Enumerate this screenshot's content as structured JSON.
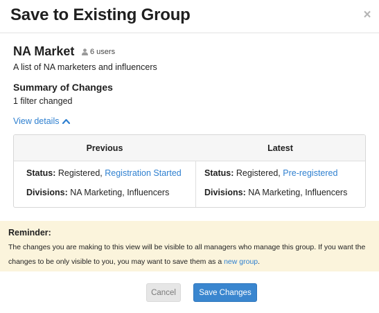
{
  "dialog": {
    "title": "Save to Existing Group",
    "close_glyph": "×"
  },
  "group": {
    "name": "NA Market",
    "user_count": "6 users",
    "user_icon": "user-icon",
    "description": "A list of NA marketers and influencers"
  },
  "summary": {
    "title": "Summary of Changes",
    "subtitle": "1 filter changed",
    "view_details": "View details",
    "view_details_icon": "chevron-up-icon"
  },
  "comparison": {
    "headers": [
      "Previous",
      "Latest"
    ],
    "previous": {
      "status_label": "Status:",
      "status_value": " Registered, ",
      "status_link": "Registration Started",
      "divisions_label": "Divisions:",
      "divisions_value": " NA Marketing, Influencers"
    },
    "latest": {
      "status_label": "Status:",
      "status_value": " Registered, ",
      "status_link": "Pre-registered",
      "divisions_label": "Divisions:",
      "divisions_value": " NA Marketing, Influencers"
    }
  },
  "reminder": {
    "title": "Reminder:",
    "body_text": "The changes you are making to this view will be visible to all managers who manage this group. If you want the changes to be only visible to you, you may want to save them as a ",
    "link_text": "new group",
    "body_end": "."
  },
  "buttons": {
    "cancel": "Cancel",
    "save": "Save Changes"
  },
  "colors": {
    "link": "#2f80d0",
    "primary_button": "#3a86cf",
    "reminder_background": "#fbf4dc"
  }
}
